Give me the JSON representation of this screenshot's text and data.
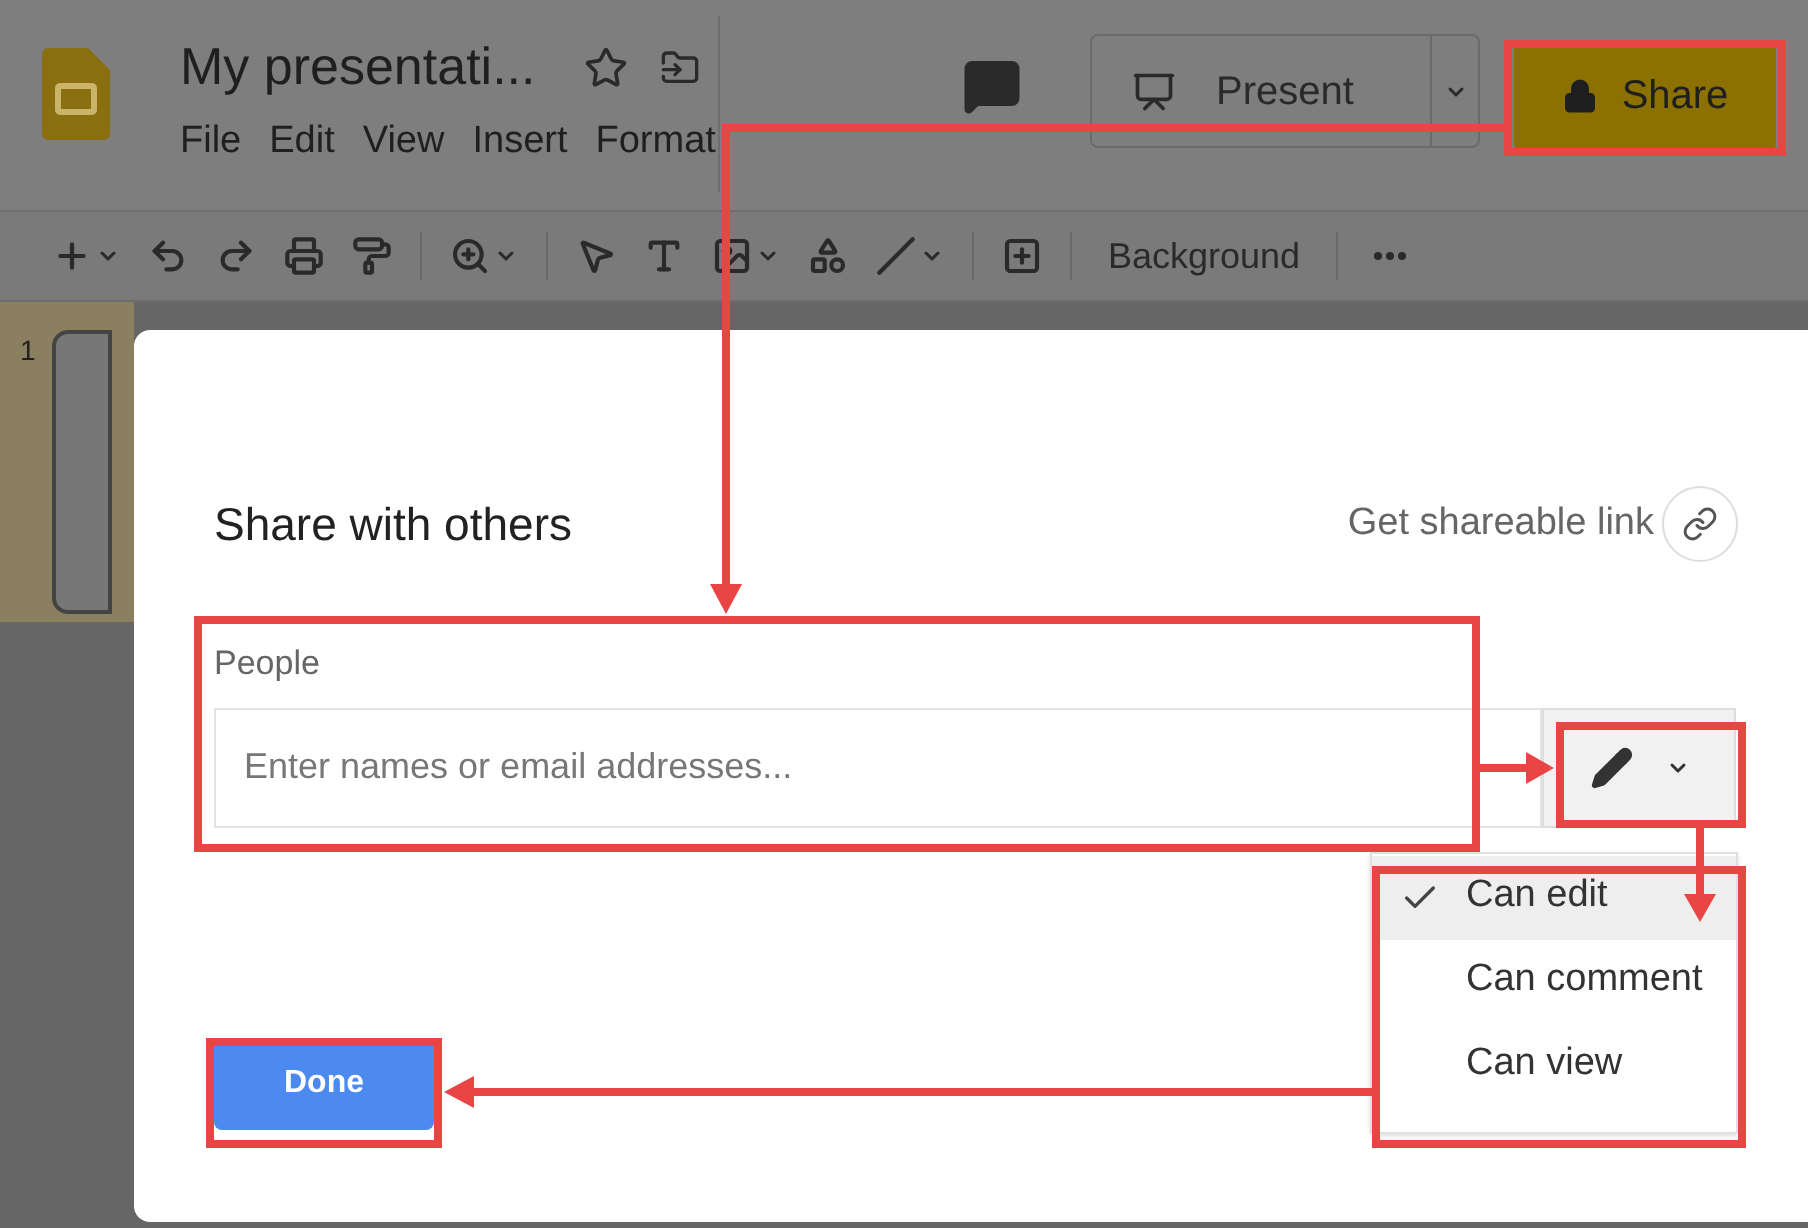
{
  "app": {
    "title": "My presentati...",
    "menu": [
      "File",
      "Edit",
      "View",
      "Insert",
      "Format"
    ],
    "present_button": "Present",
    "share_button": "Share"
  },
  "toolbar": {
    "background_button": "Background"
  },
  "filmstrip": {
    "slide_number": "1"
  },
  "dialog": {
    "title": "Share with others",
    "link_button": "Get shareable link",
    "people": {
      "label": "People",
      "placeholder": "Enter names or email addresses..."
    },
    "permissions": [
      {
        "label": "Can edit",
        "selected": true
      },
      {
        "label": "Can comment",
        "selected": false
      },
      {
        "label": "Can view",
        "selected": false
      }
    ],
    "done_button": "Done"
  }
}
